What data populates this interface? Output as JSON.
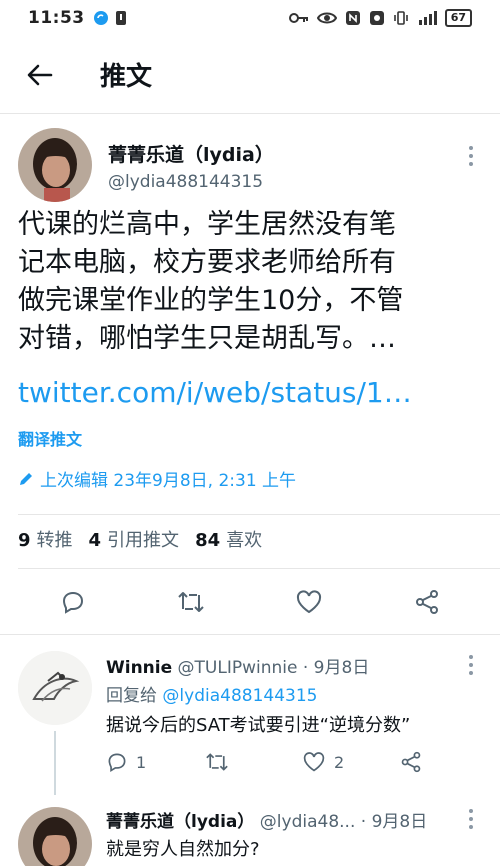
{
  "status_bar": {
    "time": "11:53",
    "battery": "67"
  },
  "header": {
    "title": "推文"
  },
  "tweet": {
    "author_name": "菁菁乐道（lydia）",
    "author_handle": "@lydia488144315",
    "text_lines": [
      "代课的烂高中，学生居然没有笔",
      "记本电脑，校方要求老师给所有",
      "做完课堂作业的学生10分，不管",
      "对错，哪怕学生只是胡乱写。…"
    ],
    "link": "twitter.com/i/web/status/1…",
    "translate_label": "翻译推文",
    "edited_label": "上次编辑 23年9月8日, 2:31 上午",
    "stats": {
      "retweets_count": "9",
      "retweets_label": "转推",
      "quotes_count": "4",
      "quotes_label": "引用推文",
      "likes_count": "84",
      "likes_label": "喜欢"
    }
  },
  "replies": [
    {
      "name": "Winnie",
      "handle": "@TULIPwinnie",
      "date": "· 9月8日",
      "reply_to_prefix": "回复给",
      "reply_to_handle": "@lydia488144315",
      "text": "据说今后的SAT考试要引进“逆境分数”",
      "reply_count": "1",
      "retweet_count": "",
      "like_count": "2"
    },
    {
      "name": "菁菁乐道（lydia）",
      "handle": "@lydia48...",
      "date": "· 9月8日",
      "text": "就是穷人自然加分?"
    }
  ],
  "colors": {
    "accent": "#1d9bf0",
    "text": "#0f1419",
    "muted": "#536471"
  }
}
